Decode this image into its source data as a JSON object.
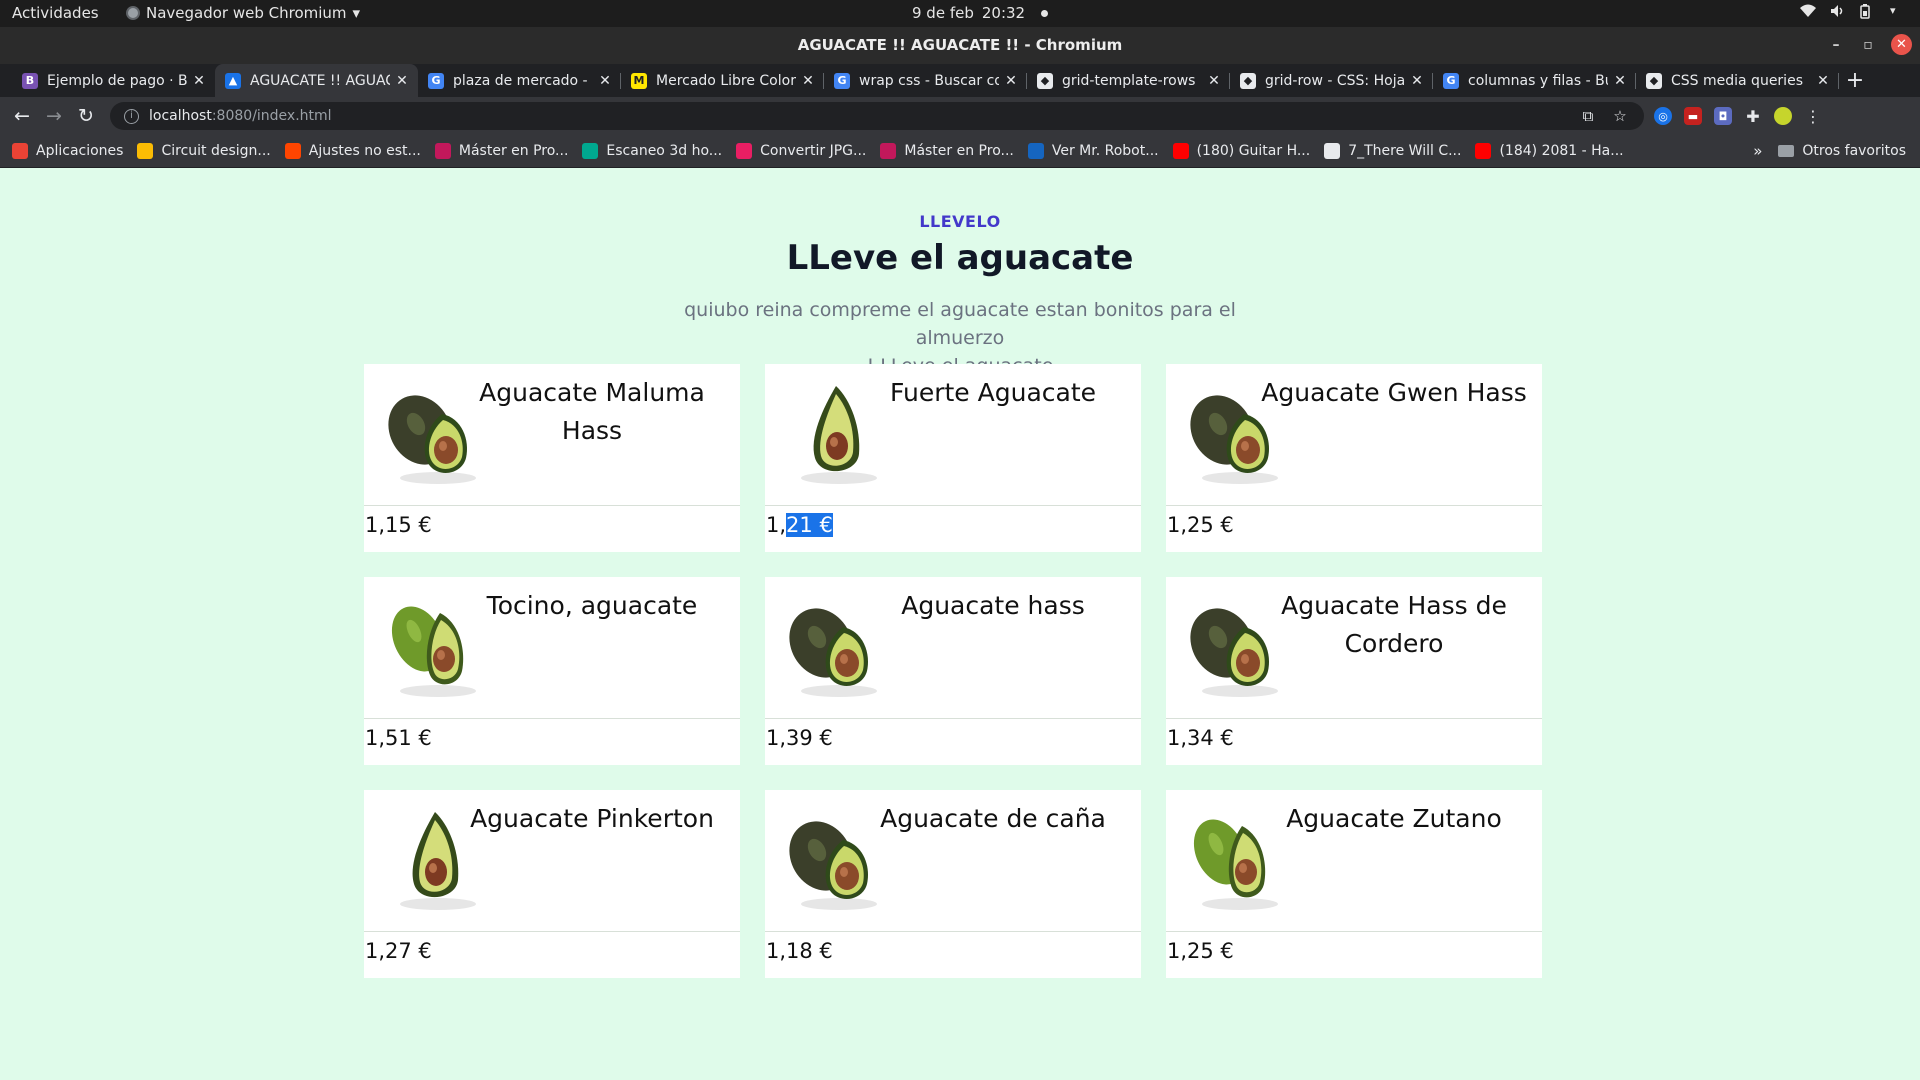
{
  "system_bar": {
    "activities": "Actividades",
    "app_name": "Navegador web Chromium",
    "date": "9 de feb",
    "time": "20:32"
  },
  "window": {
    "title": "AGUACATE !! AGUACATE !! - Chromium"
  },
  "tabs": [
    {
      "label": "Ejemplo de pago · B",
      "color": "#7952b3",
      "glyph": "B"
    },
    {
      "label": "AGUACATE !! AGUAC",
      "color": "#1a73e8",
      "glyph": "▲",
      "active": true
    },
    {
      "label": "plaza de mercado - B",
      "color": "#4285f4",
      "glyph": "G"
    },
    {
      "label": "Mercado Libre Color",
      "color": "#ffe600",
      "glyph": "M"
    },
    {
      "label": "wrap css - Buscar co",
      "color": "#4285f4",
      "glyph": "G"
    },
    {
      "label": "grid-template-rows",
      "color": "#e8eaed",
      "glyph": "◆"
    },
    {
      "label": "grid-row - CSS: Hojas",
      "color": "#e8eaed",
      "glyph": "◆"
    },
    {
      "label": "columnas y filas - Bú",
      "color": "#4285f4",
      "glyph": "G"
    },
    {
      "label": "CSS media queries",
      "color": "#e8eaed",
      "glyph": "◆"
    }
  ],
  "address_bar": {
    "host": "localhost",
    "path": ":8080/index.html"
  },
  "bookmarks": [
    {
      "label": "Aplicaciones",
      "color": "#ea4335"
    },
    {
      "label": "Circuit design...",
      "color": "#fbbc04"
    },
    {
      "label": "Ajustes no est...",
      "color": "#ff4500"
    },
    {
      "label": "Máster en Pro...",
      "color": "#c2185b"
    },
    {
      "label": "Escaneo 3d ho...",
      "color": "#00a88f"
    },
    {
      "label": "Convertir JPG...",
      "color": "#e91e63"
    },
    {
      "label": "Máster en Pro...",
      "color": "#c2185b"
    },
    {
      "label": "Ver Mr. Robot...",
      "color": "#1565c0"
    },
    {
      "label": "(180) Guitar H...",
      "color": "#ff0000"
    },
    {
      "label": "7_There Will C...",
      "color": "#e8eaed"
    },
    {
      "label": "(184) 2081 - Ha...",
      "color": "#ff0000"
    }
  ],
  "bookmarks_more": "»",
  "bookmarks_folder": "Otros favoritos",
  "page": {
    "eyebrow": "LLEVELO",
    "headline": "LLeve el aguacate",
    "lead_line1": "quiubo reina compreme el aguacate estan bonitos para el almuerzo",
    "lead_line2": "! LLeve el aguacate"
  },
  "products": [
    {
      "name": "Aguacate Maluma Hass",
      "price": "1,15 €",
      "variant": "whole-half"
    },
    {
      "name": "Fuerte Aguacate",
      "price_pre": "1,",
      "price_sel": "21 €",
      "variant": "half"
    },
    {
      "name": "Aguacate Gwen Hass",
      "price": "1,25 €",
      "variant": "whole-half"
    },
    {
      "name": "Tocino, aguacate",
      "price": "1,51 €",
      "variant": "green"
    },
    {
      "name": "Aguacate hass",
      "price": "1,39 €",
      "variant": "whole-half"
    },
    {
      "name": "Aguacate Hass de Cordero",
      "price": "1,34 €",
      "variant": "whole-half"
    },
    {
      "name": "Aguacate Pinkerton",
      "price": "1,27 €",
      "variant": "half"
    },
    {
      "name": "Aguacate de caña",
      "price": "1,18 €",
      "variant": "whole-half"
    },
    {
      "name": "Aguacate Zutano",
      "price": "1,25 €",
      "variant": "green"
    }
  ]
}
